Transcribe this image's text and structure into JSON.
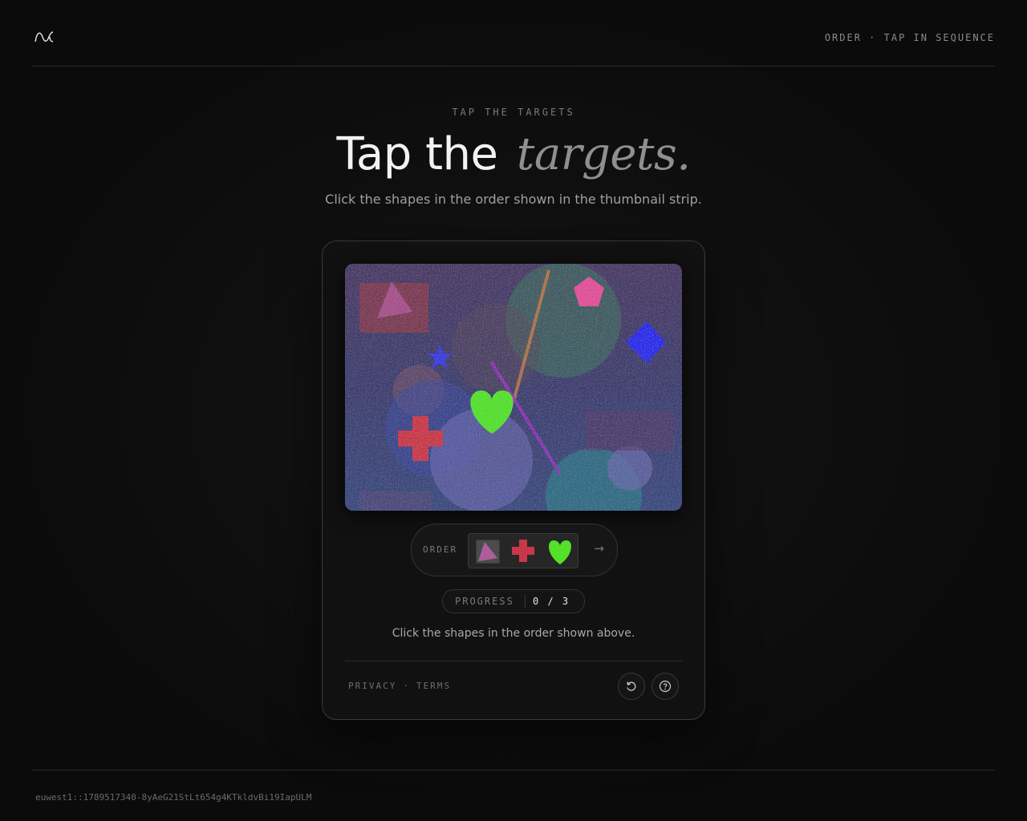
{
  "header": {
    "logo_icon": "wave-logo-icon",
    "mode_label": "ORDER · TAP IN SEQUENCE"
  },
  "hero": {
    "eyebrow": "TAP THE TARGETS",
    "title_main": "Tap the",
    "title_emphasis": "targets.",
    "subtitle": "Click the shapes in the order shown in the thumbnail strip."
  },
  "challenge": {
    "order_label": "ORDER",
    "order_sequence": [
      "triangle",
      "cross",
      "heart"
    ],
    "next_icon": "arrow-right-icon",
    "progress_label": "PROGRESS",
    "progress_value": "0 / 3",
    "instruction": "Click the shapes in the order shown above.",
    "footer": {
      "privacy": "PRIVACY",
      "separator": "·",
      "terms": "TERMS",
      "refresh_icon": "refresh-icon",
      "help_icon": "help-icon"
    }
  },
  "colors": {
    "accent_green": "#55e02a",
    "blue": "#2a2ae8",
    "pink": "#e0509a",
    "red": "#c8384a"
  },
  "session_id": "euwest1::1789517340-8yAeG21StLt654g4KTkldvBi19IapULM"
}
